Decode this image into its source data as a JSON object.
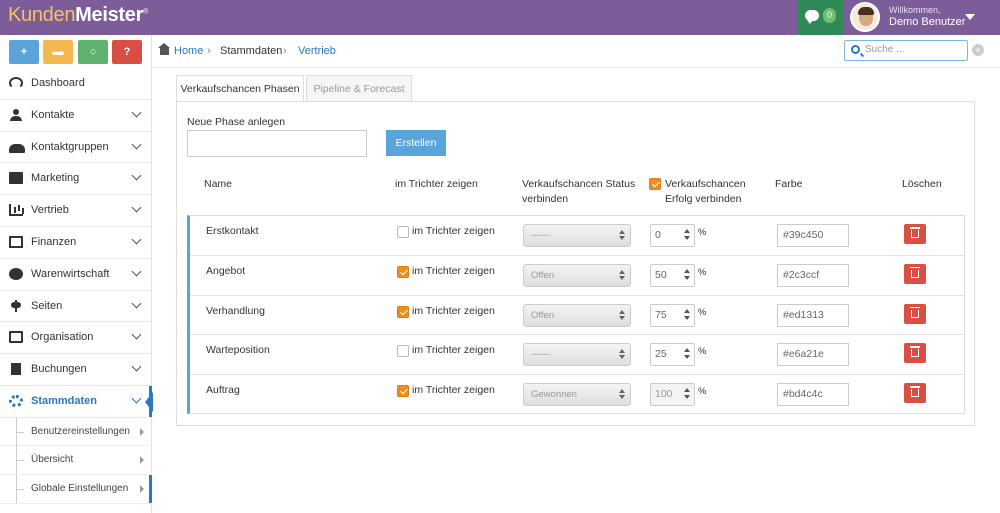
{
  "app": {
    "logo_part1": "Kunden",
    "logo_part2": "Meister",
    "logo_reg": "®",
    "chat_count": "0",
    "welcome": "Willkommen,",
    "user_name": "Demo Benutzer"
  },
  "colors": {
    "topbar": "#7d5c9a",
    "accent": "#2a77c4",
    "chat_box": "#2f8a58",
    "delete": "#d94f43",
    "checkbox_on": "#f08c1a"
  },
  "quick_buttons": [
    {
      "label": "+",
      "icon": "plus-icon"
    },
    {
      "label": "",
      "icon": "chat-icon"
    },
    {
      "label": "",
      "icon": "search-icon"
    },
    {
      "label": "?",
      "icon": "help-icon"
    }
  ],
  "sidebar": {
    "items": [
      {
        "label": "Dashboard",
        "icon": "dashboard-icon"
      },
      {
        "label": "Kontakte",
        "icon": "user-icon"
      },
      {
        "label": "Kontaktgruppen",
        "icon": "group-icon"
      },
      {
        "label": "Marketing",
        "icon": "envelope-icon"
      },
      {
        "label": "Vertrieb",
        "icon": "bar-chart-icon"
      },
      {
        "label": "Finanzen",
        "icon": "money-icon"
      },
      {
        "label": "Warenwirtschaft",
        "icon": "globe-icon"
      },
      {
        "label": "Seiten",
        "icon": "sitemap-icon"
      },
      {
        "label": "Organisation",
        "icon": "edit-icon"
      },
      {
        "label": "Buchungen",
        "icon": "bookmark-icon"
      },
      {
        "label": "Stammdaten",
        "icon": "gears-icon",
        "active": true
      }
    ],
    "subitems": [
      {
        "label": "Benutzereinstellungen"
      },
      {
        "label": "Übersicht"
      },
      {
        "label": "Globale Einstellungen"
      }
    ]
  },
  "breadcrumb": {
    "home": "Home",
    "sep": "›",
    "level1": "Stammdaten",
    "level2": "Vertrieb"
  },
  "search": {
    "placeholder": "Suche ..."
  },
  "tabs": [
    {
      "label": "Verkaufschancen Phasen",
      "active": true
    },
    {
      "label": "Pipeline & Forecast",
      "active": false
    }
  ],
  "form": {
    "new_phase_label": "Neue Phase anlegen",
    "new_phase_value": "",
    "create_button": "Erstellen"
  },
  "table": {
    "headers": {
      "name": "Name",
      "trichter": "im Trichter zeigen",
      "status": "Verkaufschancen Status verbinden",
      "erfolg": "Verkaufschancen Erfolg verbinden",
      "farbe": "Farbe",
      "loeschen": "Löschen"
    },
    "erfolg_header_checked": true,
    "percent_sign": "%",
    "checkbox_label": "im Trichter zeigen",
    "rows": [
      {
        "name": "Erstkontakt",
        "trichter": false,
        "status": "------",
        "erfolg": "0",
        "erfolg_disabled": false,
        "farbe": "#39c450"
      },
      {
        "name": "Angebot",
        "trichter": true,
        "status": "Offen",
        "erfolg": "50",
        "erfolg_disabled": false,
        "farbe": "#2c3ccf"
      },
      {
        "name": "Verhandlung",
        "trichter": true,
        "status": "Offen",
        "erfolg": "75",
        "erfolg_disabled": false,
        "farbe": "#ed1313"
      },
      {
        "name": "Warteposition",
        "trichter": false,
        "status": "------",
        "erfolg": "25",
        "erfolg_disabled": false,
        "farbe": "#e6a21e"
      },
      {
        "name": "Auftrag",
        "trichter": true,
        "status": "Gewonnen",
        "erfolg": "100",
        "erfolg_disabled": true,
        "farbe": "#bd4c4c"
      }
    ]
  }
}
